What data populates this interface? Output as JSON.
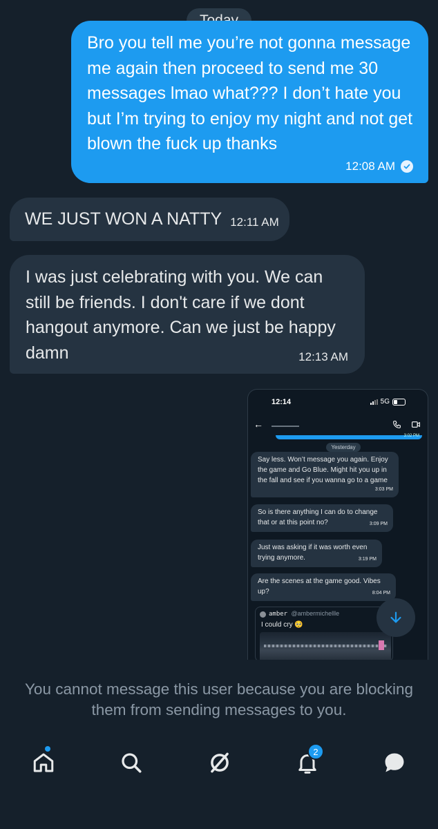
{
  "date_divider": "Today",
  "messages": [
    {
      "text": "Bro you tell me you’re not gonna message me again then proceed to send me 30 messages lmao what??? I don’t hate you but I’m trying to enjoy my night and not get blown the fuck up thanks",
      "time": "12:08 AM",
      "direction": "sent",
      "status": "read"
    },
    {
      "text": "WE JUST WON A NATTY",
      "time": "12:11 AM",
      "direction": "received"
    },
    {
      "text": "I was just celebrating with you. We can still be friends. I don't care if we dont hangout anymore. Can we just be happy damn",
      "time": "12:13 AM",
      "direction": "received"
    }
  ],
  "attachment": {
    "status_time": "12:14",
    "network": "5G",
    "top_stamp": "3:02 PM",
    "divider": "Yesterday",
    "messages": [
      {
        "text": "Say less. Won’t message you again. Enjoy the game and Go Blue.  Might hit you up in the fall and see if you wanna go to a game",
        "time": "3:03 PM"
      },
      {
        "text": "So is there anything I can do to change that or at this point no?",
        "time": "3:09 PM"
      },
      {
        "text": "Just was asking if it was worth even trying anymore.",
        "time": "3:19 PM"
      },
      {
        "text": "Are the scenes at the game good. Vibes up?",
        "time": "8:04 PM"
      }
    ],
    "quoted_tweet": {
      "name": "amber",
      "handle": "@ambermichellle",
      "text": "I could cry 🥺"
    }
  },
  "blocked_notice": "You cannot message this user because you are blocking them from sending messages to you.",
  "tabs": [
    {
      "icon": "home-icon",
      "has_dot": true
    },
    {
      "icon": "search-icon"
    },
    {
      "icon": "grok-icon"
    },
    {
      "icon": "bell-icon",
      "badge": "2"
    },
    {
      "icon": "messages-icon"
    }
  ],
  "colors": {
    "background": "#15202b",
    "accent": "#1d9bf0",
    "received_bubble": "#253341",
    "muted_text": "#8b98a5"
  }
}
